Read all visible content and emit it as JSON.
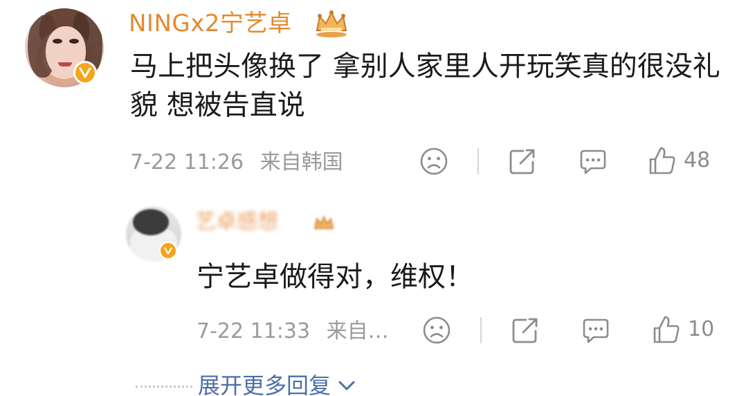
{
  "main_comment": {
    "username": "NINGx2宁艺卓",
    "content": "马上把头像换了 拿别人家里人开玩笑真的很没礼貌 想被告直说",
    "timestamp": "7-22 11:26",
    "location": "来自韩国",
    "like_count": "48"
  },
  "reply": {
    "username": "艺卓感想",
    "content": "宁艺卓做得对，维权！",
    "timestamp": "7-22 11:33",
    "location": "来自…",
    "like_count": "10"
  },
  "footer": {
    "expand_label": "展开更多回复"
  },
  "colors": {
    "username": "#e48a2e",
    "verified": "#f4a51c",
    "meta_text": "#9a9a9a",
    "link": "#4a6ea8"
  },
  "icons": [
    "sad-face-icon",
    "share-icon",
    "comment-icon",
    "like-icon",
    "chevron-down-icon",
    "verified-icon",
    "crown-icon"
  ]
}
